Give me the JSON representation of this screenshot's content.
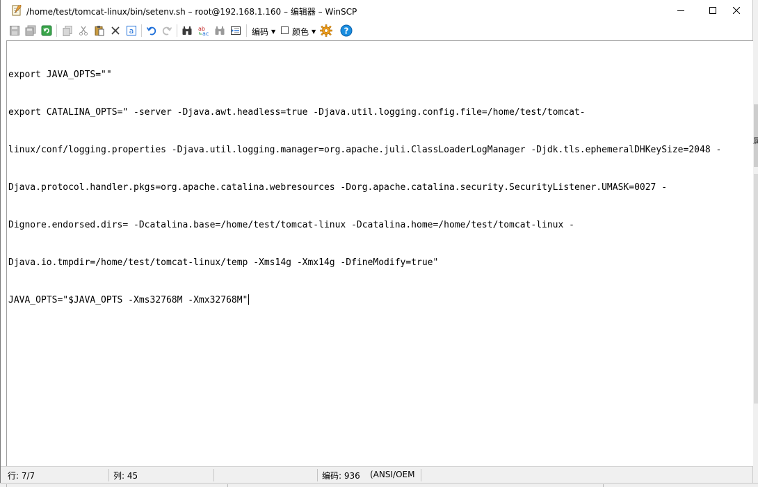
{
  "window": {
    "title": "/home/test/tomcat-linux/bin/setenv.sh – root@192.168.1.160 – 编辑器 – WinSCP",
    "controls": {
      "minimize": "minimize-icon",
      "maximize": "maximize-icon",
      "close": "close-icon"
    }
  },
  "toolbar": {
    "encoding_label": "编码",
    "color_label": "颜色",
    "color_checked": false,
    "icons": [
      "save-icon",
      "save-all-icon",
      "reload-icon",
      "copy-icon",
      "cut-icon",
      "paste-icon",
      "delete-icon",
      "select-all-icon",
      "undo-icon",
      "redo-icon",
      "find-icon",
      "replace-icon",
      "find-next-icon",
      "goto-line-icon",
      "settings-icon",
      "help-icon"
    ]
  },
  "editor": {
    "lines": [
      "export JAVA_OPTS=\"\"",
      "export CATALINA_OPTS=\" -server -Djava.awt.headless=true -Djava.util.logging.config.file=/home/test/tomcat-",
      "linux/conf/logging.properties -Djava.util.logging.manager=org.apache.juli.ClassLoaderLogManager -Djdk.tls.ephemeralDHKeySize=2048 -",
      "Djava.protocol.handler.pkgs=org.apache.catalina.webresources -Dorg.apache.catalina.security.SecurityListener.UMASK=0027 -",
      "Dignore.endorsed.dirs= -Dcatalina.base=/home/test/tomcat-linux -Dcatalina.home=/home/test/tomcat-linux -",
      "Djava.io.tmpdir=/home/test/tomcat-linux/temp -Xms14g -Xmx14g -DfineModify=true\"",
      "JAVA_OPTS=\"$JAVA_OPTS -Xms32768M -Xmx32768M\""
    ]
  },
  "statusbar": {
    "line": "行: 7/7",
    "column": "列: 45",
    "encoding": "编码: 936",
    "charset": "(ANSI/OEM"
  },
  "colors": {
    "accent_blue": "#1e6fd9",
    "help_blue": "#1a8ee0",
    "settings_orange": "#f0a020",
    "statusbar_bg": "#f0f0f0"
  },
  "background": {
    "right_glyph": "属"
  }
}
